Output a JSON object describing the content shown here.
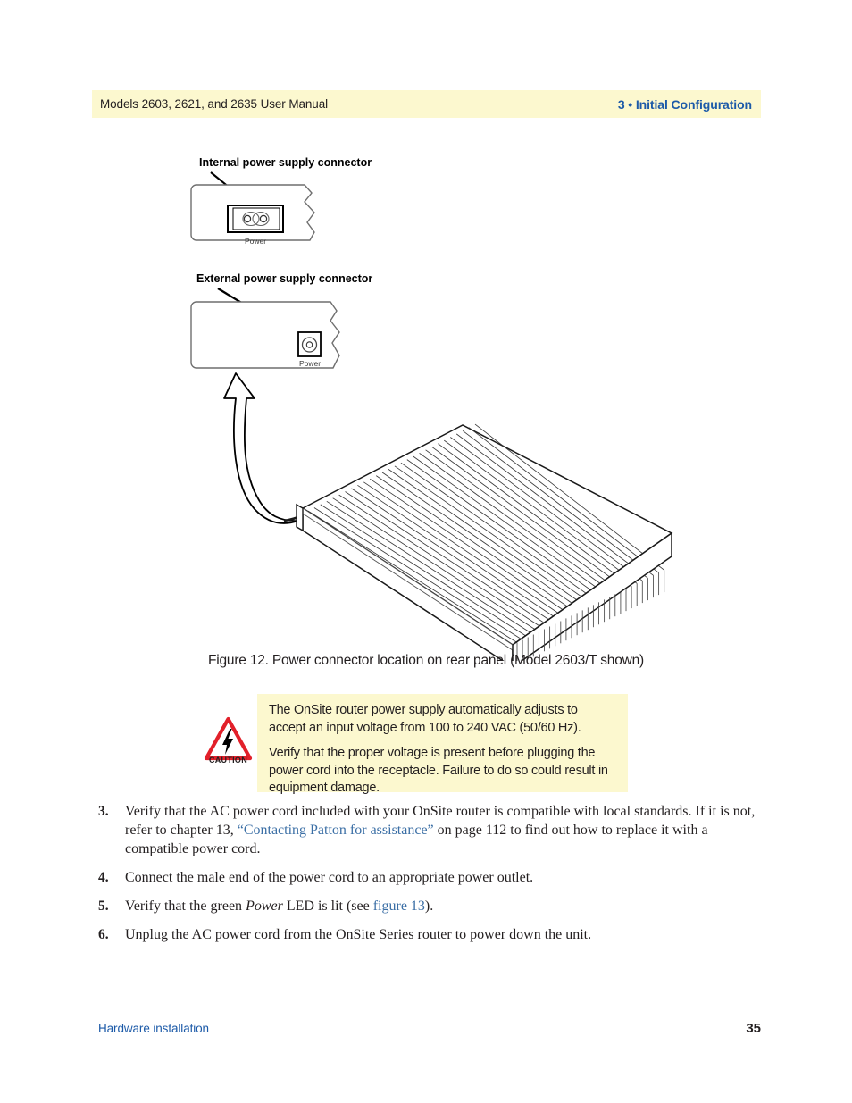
{
  "header": {
    "left": "Models 2603, 2621, and 2635 User Manual",
    "right": "3 • Initial Configuration"
  },
  "figure": {
    "internal_label": "Internal power supply connector",
    "external_label": "External power supply connector",
    "internal_port_caption": "Power",
    "external_port_caption": "Power",
    "caption": "Figure 12. Power connector location on rear panel (Model 2603/T shown)"
  },
  "caution": {
    "word": "CAUTION",
    "icon": "warning-triangle-lightning-icon",
    "paragraph1": "The OnSite router power supply automatically adjusts to accept an input voltage from 100 to 240 VAC (50/60 Hz).",
    "paragraph2": "Verify that the proper voltage is present before plugging the power cord into the receptacle. Failure to do so could result in equipment damage."
  },
  "steps": [
    {
      "num": "3.",
      "parts": [
        {
          "t": "Verify that the AC power cord included with your OnSite router is compatible with local standards. If it is not, refer to chapter 13, ",
          "s": "plain"
        },
        {
          "t": "“Contacting Patton for assistance”",
          "s": "link"
        },
        {
          "t": " on page 112 to find out how to replace it with a compatible power cord.",
          "s": "plain"
        }
      ]
    },
    {
      "num": "4.",
      "parts": [
        {
          "t": "Connect the male end of the power cord to an appropriate power outlet.",
          "s": "plain"
        }
      ]
    },
    {
      "num": "5.",
      "parts": [
        {
          "t": "Verify that the green ",
          "s": "plain"
        },
        {
          "t": "Power",
          "s": "italic"
        },
        {
          "t": " LED is lit (see ",
          "s": "plain"
        },
        {
          "t": "figure 13",
          "s": "link"
        },
        {
          "t": ").",
          "s": "plain"
        }
      ]
    },
    {
      "num": "6.",
      "parts": [
        {
          "t": "Unplug the AC power cord from the OnSite Series router to power down the unit.",
          "s": "plain"
        }
      ]
    }
  ],
  "footer": {
    "left": "Hardware installation",
    "right": "35"
  },
  "colors": {
    "band": "#fcf8cf",
    "header_blue": "#1c5aa8",
    "link_blue": "#3a6ea5",
    "caution_red": "#e2202a",
    "text": "#231f20"
  }
}
